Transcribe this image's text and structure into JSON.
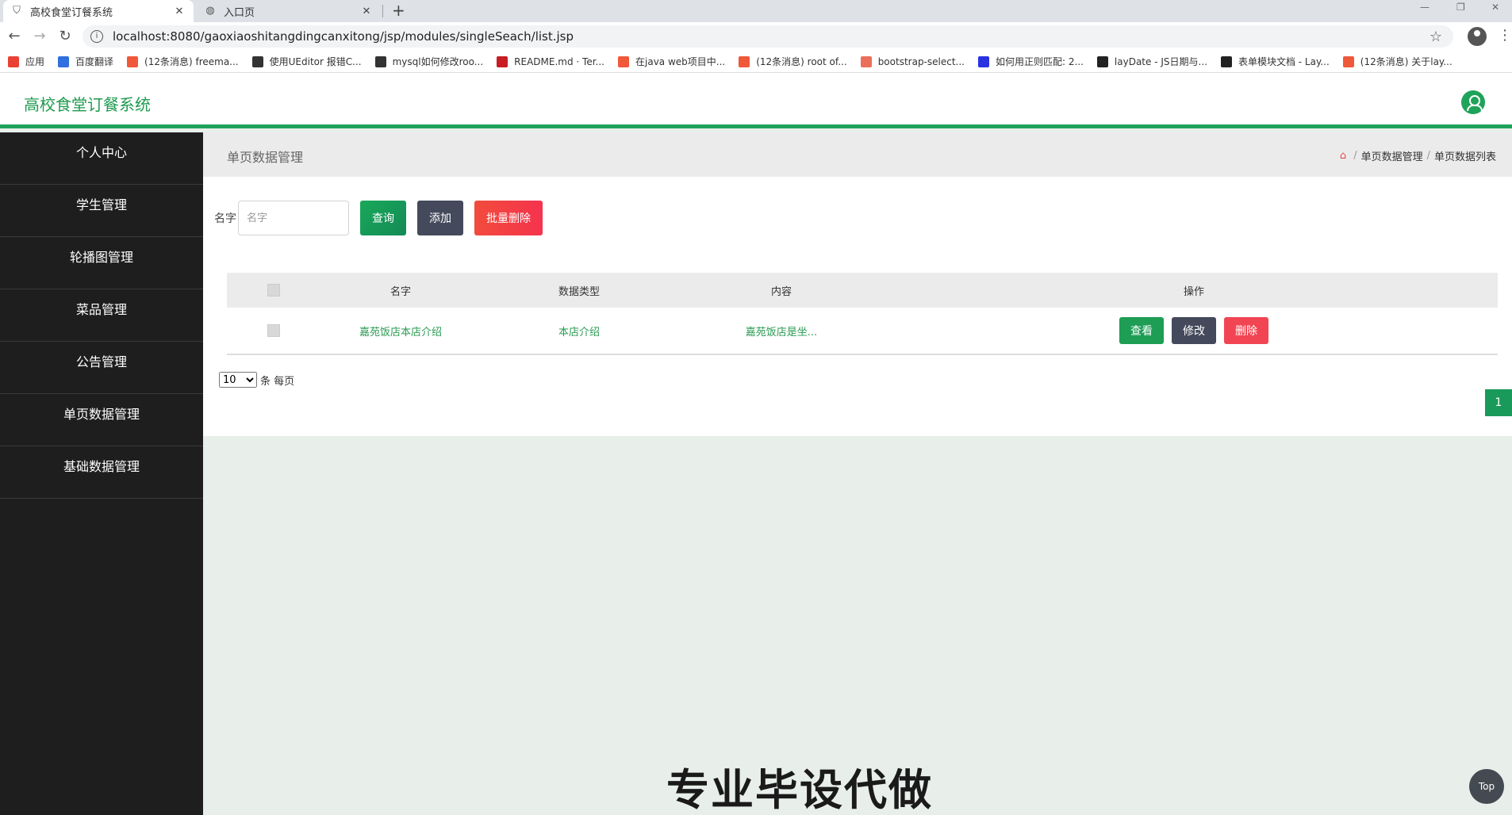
{
  "browser": {
    "tabs": [
      {
        "label": "高校食堂订餐系统",
        "active": true
      },
      {
        "label": "入口页",
        "active": false
      }
    ],
    "url": "localhost:8080/gaoxiaoshitangdingcanxitong/jsp/modules/singleSeach/list.jsp",
    "bookmarks": [
      {
        "label": "应用",
        "icon": "apps-icon",
        "color": "#e94235"
      },
      {
        "label": "百度翻译",
        "icon": "baidu-translate-icon",
        "color": "#2f6fde"
      },
      {
        "label": "(12条消息) freema...",
        "icon": "csdn-icon",
        "color": "#f0583a"
      },
      {
        "label": "使用UEditor 报错C...",
        "icon": "segmentfault-icon",
        "color": "#333333"
      },
      {
        "label": "mysql如何修改roo...",
        "icon": "segmentfault-icon",
        "color": "#333333"
      },
      {
        "label": "README.md · Ter...",
        "icon": "gitee-icon",
        "color": "#c71d23"
      },
      {
        "label": "在java web项目中...",
        "icon": "csdn-icon",
        "color": "#f0583a"
      },
      {
        "label": "(12条消息) root of...",
        "icon": "csdn-icon",
        "color": "#f0583a"
      },
      {
        "label": "bootstrap-select...",
        "icon": "jianshu-icon",
        "color": "#ea6f5a"
      },
      {
        "label": "如何用正则匹配: 2...",
        "icon": "baidu-icon",
        "color": "#2932e1"
      },
      {
        "label": "layDate - JS日期与...",
        "icon": "layui-icon",
        "color": "#222222"
      },
      {
        "label": "表单模块文档 - Lay...",
        "icon": "layui-icon",
        "color": "#222222"
      },
      {
        "label": "(12条消息) 关于lay...",
        "icon": "csdn-icon",
        "color": "#f0583a"
      }
    ]
  },
  "app": {
    "title": "高校食堂订餐系统",
    "accent": "#1fa35a"
  },
  "sidebar": {
    "items": [
      {
        "label": "个人中心"
      },
      {
        "label": "学生管理"
      },
      {
        "label": "轮播图管理"
      },
      {
        "label": "菜品管理"
      },
      {
        "label": "公告管理"
      },
      {
        "label": "单页数据管理"
      },
      {
        "label": "基础数据管理"
      }
    ]
  },
  "page": {
    "title": "单页数据管理",
    "breadcrumb": [
      "单页数据管理",
      "单页数据列表"
    ]
  },
  "search": {
    "label": "名字",
    "placeholder": "名字",
    "query_button": "查询",
    "add_button": "添加",
    "batch_delete_button": "批量删除"
  },
  "table": {
    "headers": [
      "名字",
      "数据类型",
      "内容",
      "操作"
    ],
    "rows": [
      {
        "name": "嘉苑饭店本店介绍",
        "type": "本店介绍",
        "content": "嘉苑饭店是坐..."
      }
    ],
    "actions": {
      "view": "查看",
      "edit": "修改",
      "delete": "删除"
    }
  },
  "pagination": {
    "page_size": "10",
    "page_size_options": [
      "10"
    ],
    "suffix": "条 每页",
    "current_page": "1"
  },
  "overlay": {
    "watermark": "专业毕设代做",
    "top_button": "Top"
  }
}
